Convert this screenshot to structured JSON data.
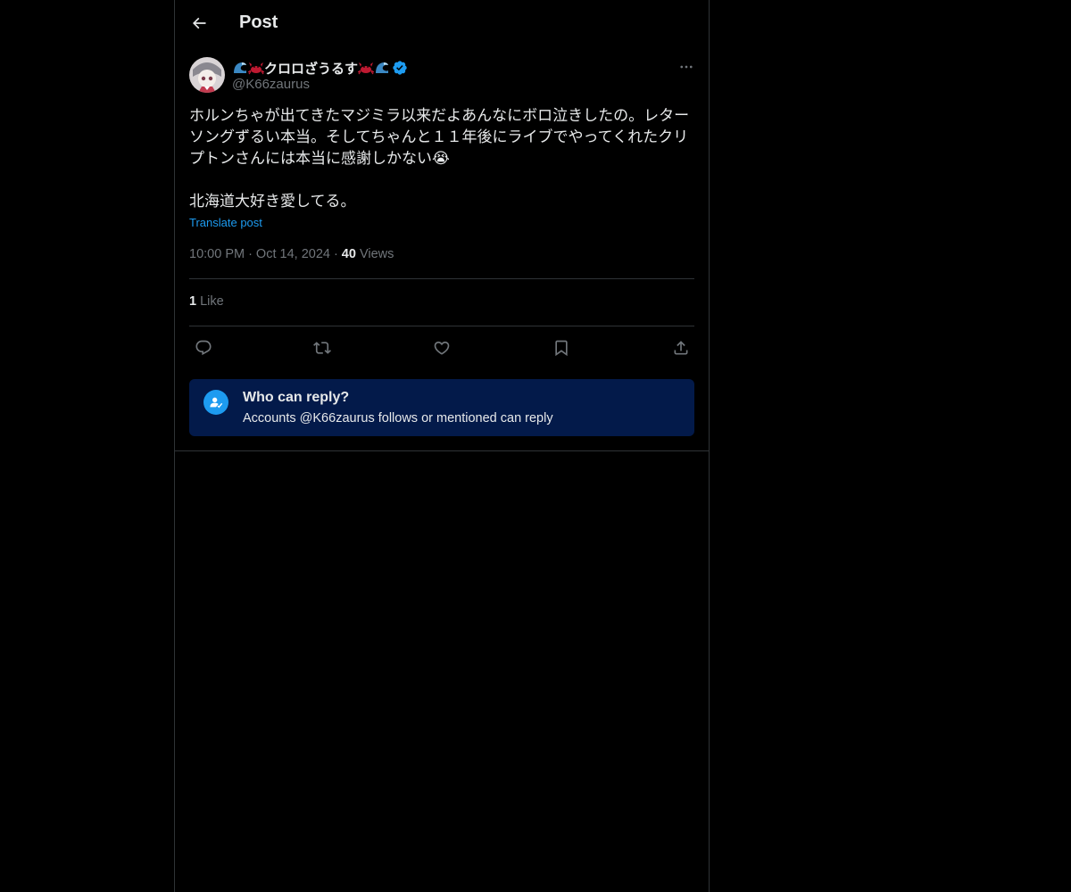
{
  "header": {
    "title": "Post",
    "back_icon": "arrow-left-icon"
  },
  "author": {
    "display_name_prefix_emojis": [
      "wave-icon",
      "crab-icon"
    ],
    "display_name": "クロロざうるす",
    "display_name_suffix_emojis": [
      "crab-icon",
      "wave-icon"
    ],
    "verified_icon": "verified-badge-icon",
    "handle": "@K66zaurus",
    "more_icon": "more-dots-icon"
  },
  "post": {
    "paragraph1": "ホルンちゃが出てきたマジミラ以来だよあんなにボロ泣きしたの。レターソングずるい本当。そしてちゃんと１１年後にライブでやってくれたクリプトンさんには本当に感謝しかない😭",
    "paragraph2": "北海道大好き愛してる。",
    "translate_label": "Translate post",
    "time": "10:00 PM",
    "date": "Oct 14, 2024",
    "views_count": "40",
    "views_label": "Views",
    "separator": "·"
  },
  "stats": {
    "likes_count": "1",
    "likes_label": "Like"
  },
  "actions": [
    "reply-icon",
    "repost-icon",
    "like-icon",
    "bookmark-icon",
    "share-icon"
  ],
  "reply_restriction": {
    "title": "Who can reply?",
    "subtitle": "Accounts @K66zaurus follows or mentioned can reply"
  },
  "colors": {
    "background": "#000000",
    "accent": "#1d9bf0",
    "muted": "#71767b",
    "text": "#e7e9ea",
    "reply_box": "#031a4a"
  }
}
